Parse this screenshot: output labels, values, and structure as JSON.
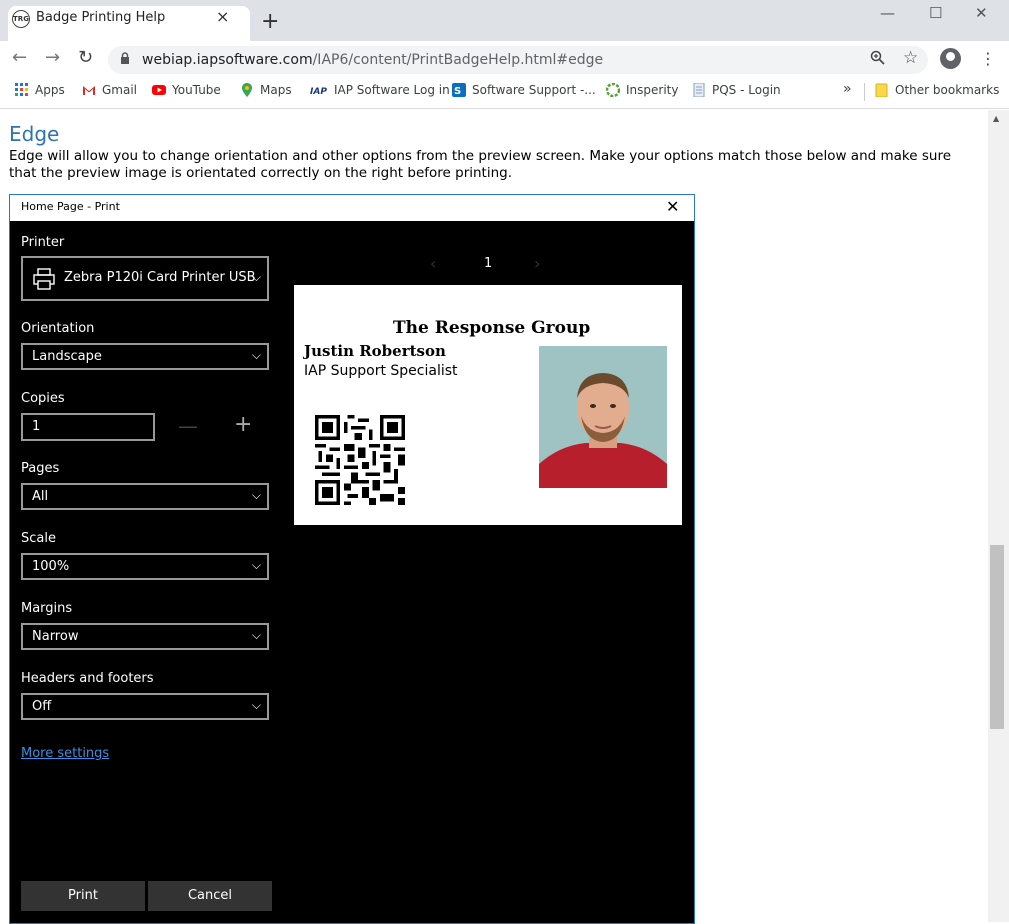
{
  "tab": {
    "favicon_text": "TRG",
    "title": "Badge Printing Help",
    "close": "×",
    "new": "+"
  },
  "window": {
    "minimize": "—",
    "maximize": "☐",
    "close": "✕"
  },
  "toolbar": {
    "back": "←",
    "forward": "→",
    "reload": "↻",
    "url_host": "webiap.iapsoftware.com",
    "url_path": "/IAP6/content/PrintBadgeHelp.html#edge"
  },
  "bookmarks": {
    "items": [
      {
        "label": "Apps",
        "icon": "apps-grid-icon"
      },
      {
        "label": "Gmail",
        "icon": "gmail-icon"
      },
      {
        "label": "YouTube",
        "icon": "youtube-icon"
      },
      {
        "label": "Maps",
        "icon": "maps-pin-icon"
      },
      {
        "label": "IAP Software Log in",
        "icon": "iap-icon"
      },
      {
        "label": "Software Support -...",
        "icon": "sharepoint-icon"
      },
      {
        "label": "Insperity",
        "icon": "insperity-icon"
      },
      {
        "label": "PQS - Login",
        "icon": "document-icon"
      }
    ],
    "overflow": "»",
    "other": "Other bookmarks"
  },
  "page": {
    "heading": "Edge",
    "paragraph": "Edge will allow you to change orientation and other options from the preview screen.  Make your options match those below and make sure that the preview image is orientated correctly on the right before printing."
  },
  "dialog": {
    "title": "Home Page - Print",
    "close": "✕",
    "printer_label": "Printer",
    "printer_value": "Zebra P120i Card Printer USB",
    "orientation_label": "Orientation",
    "orientation_value": "Landscape",
    "copies_label": "Copies",
    "copies_value": "1",
    "pages_label": "Pages",
    "pages_value": "All",
    "scale_label": "Scale",
    "scale_value": "100%",
    "margins_label": "Margins",
    "margins_value": "Narrow",
    "headers_label": "Headers and footers",
    "headers_value": "Off",
    "more_settings": "More settings",
    "print_button": "Print",
    "cancel_button": "Cancel",
    "page_number": "1"
  },
  "badge": {
    "organization": "The Response Group",
    "name": "Justin Robertson",
    "role": "IAP Support Specialist"
  },
  "colors": {
    "accent": "#2b78c8",
    "heading": "#2e74b5",
    "link": "#3d8ee0"
  }
}
